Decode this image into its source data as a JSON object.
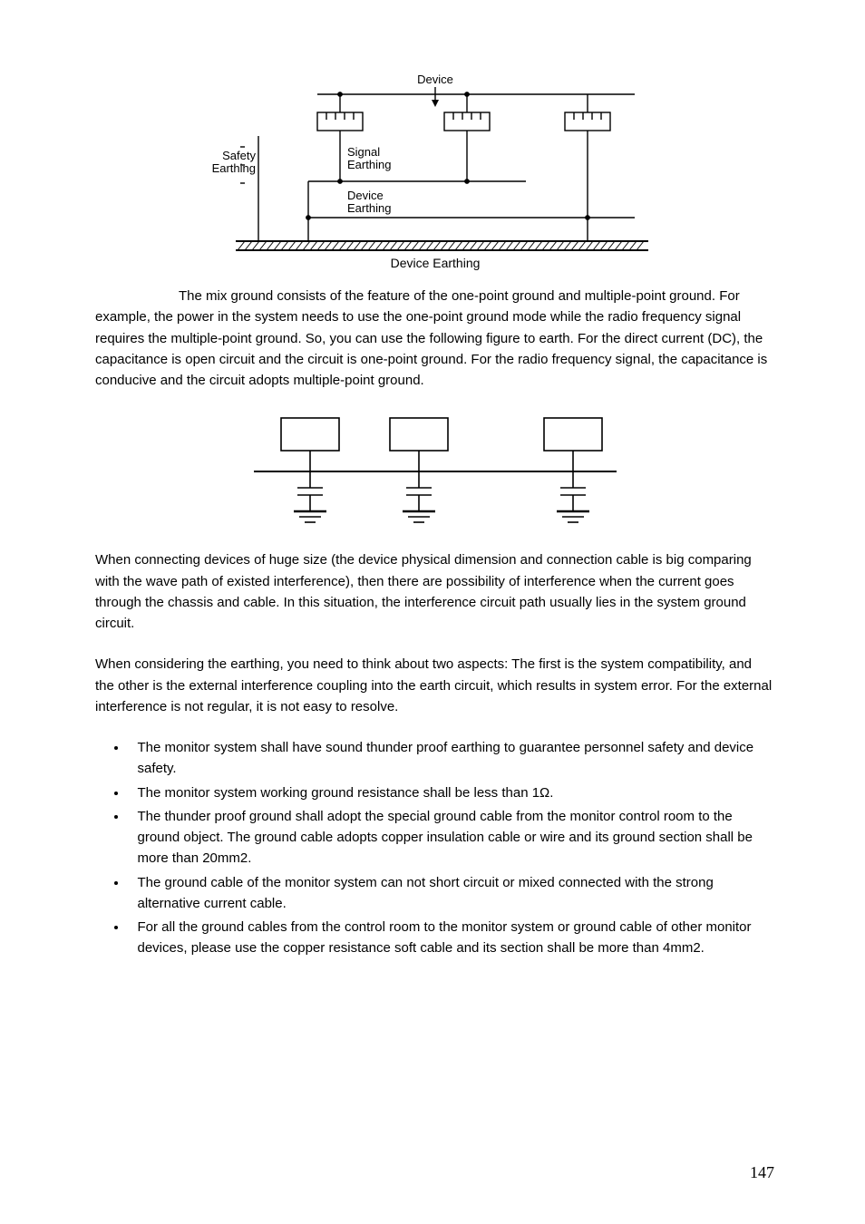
{
  "figure1": {
    "label_device_top": "Device",
    "label_safety_earthing": "Safety\nEarthing",
    "label_signal_earthing": "Signal\nEarthing",
    "label_device_earthing_mid": "Device\nEarthing",
    "caption": "Device Earthing"
  },
  "paragraphs": {
    "p1": "The mix ground consists of the feature of the one-point ground and multiple-point ground. For example, the power in the system needs to use the one-point ground mode while the radio frequency signal requires the multiple-point ground.  So, you can use the following figure to earth. For the direct current (DC), the capacitance is open circuit and the circuit is one-point ground. For the radio frequency signal, the capacitance is conducive and the circuit adopts multiple-point ground.",
    "p2": "When connecting devices of huge size (the device physical dimension and connection cable is big comparing with the wave path of existed interference), then there are possibility of interference when the current goes through the chassis and cable. In this situation, the interference circuit path usually lies in the system ground circuit.",
    "p3": "When considering the earthing, you need to think about two aspects: The first is the system compatibility, and the other is the external interference coupling into the earth circuit, which results in system error. For the external interference is not regular, it is not easy to resolve."
  },
  "bullets": [
    "The monitor system shall have sound thunder proof earthing to guarantee personnel safety and device safety.",
    "The monitor system working ground resistance shall be less than 1Ω.",
    "The thunder proof ground shall adopt the special ground cable from the monitor control room to the ground object. The ground cable adopts copper insulation cable or wire and its ground section shall be more than 20mm2.",
    "The ground cable of the monitor system can not short circuit or mixed connected with the strong alternative current cable.",
    "For all the ground cables from the control room to the monitor system or ground cable of other monitor devices, please use the copper resistance soft cable and its section shall be more than 4mm2."
  ],
  "page_number": "147"
}
